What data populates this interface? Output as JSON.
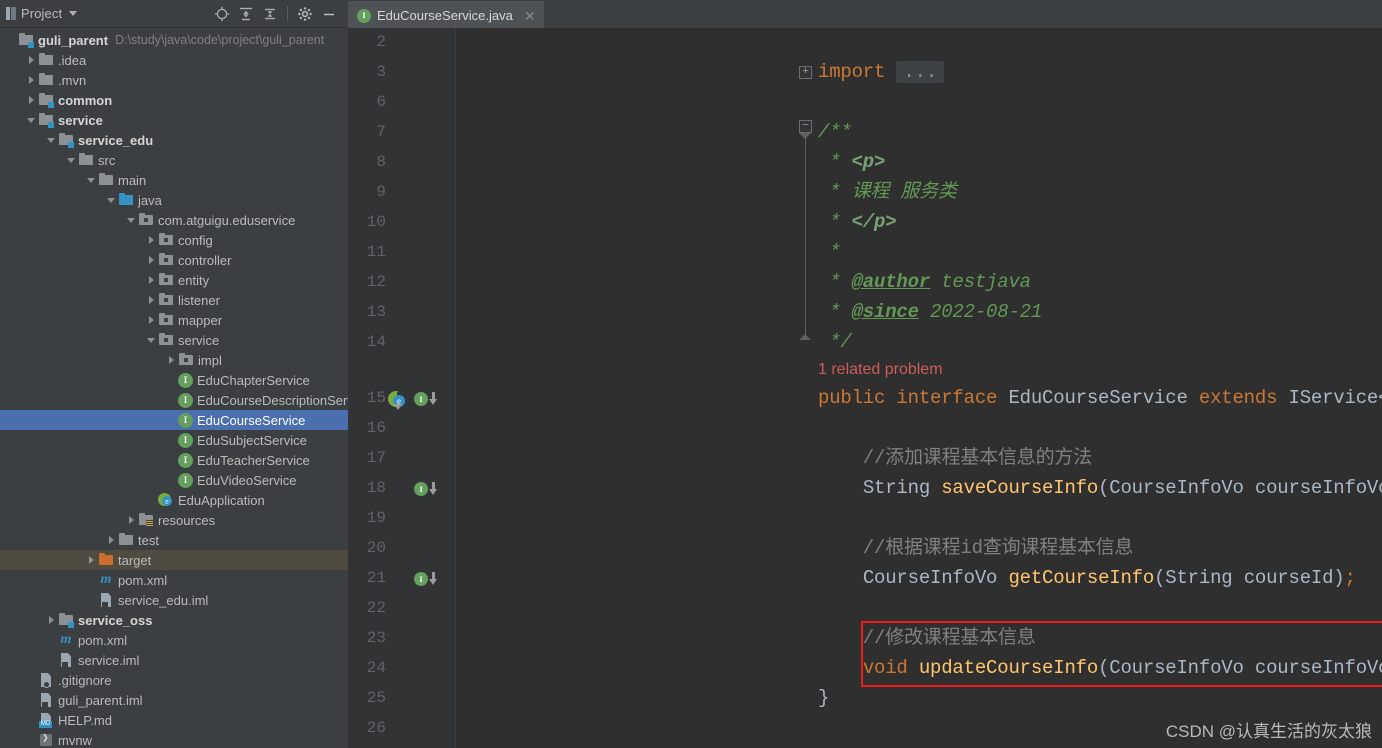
{
  "project_panel": {
    "title": "Project",
    "title_icon": "project-view-icon",
    "caret_icon": "chevron-down-icon",
    "toolbar": [
      {
        "name": "locate-file-icon",
        "label": "Select Opened File"
      },
      {
        "name": "expand-all-icon",
        "label": "Expand All"
      },
      {
        "name": "collapse-all-icon",
        "label": "Collapse All"
      },
      {
        "name": "gear-icon",
        "label": "Options"
      },
      {
        "name": "minimize-icon",
        "label": "Hide"
      }
    ],
    "tree": [
      {
        "label": "guli_parent",
        "path": "D:\\study\\java\\code\\project\\guli_parent",
        "indent": 0,
        "arrow": "none",
        "icon": "module-folder",
        "bold": true,
        "state": "normal"
      },
      {
        "label": ".idea",
        "path": "",
        "indent": 1,
        "arrow": "closed",
        "icon": "folder",
        "bold": false,
        "state": "normal"
      },
      {
        "label": ".mvn",
        "path": "",
        "indent": 1,
        "arrow": "closed",
        "icon": "folder",
        "bold": false,
        "state": "normal"
      },
      {
        "label": "common",
        "path": "",
        "indent": 1,
        "arrow": "closed",
        "icon": "module-folder",
        "bold": true,
        "state": "normal"
      },
      {
        "label": "service",
        "path": "",
        "indent": 1,
        "arrow": "open",
        "icon": "module-folder",
        "bold": true,
        "state": "normal"
      },
      {
        "label": "service_edu",
        "path": "",
        "indent": 2,
        "arrow": "open",
        "icon": "module-folder",
        "bold": true,
        "state": "normal"
      },
      {
        "label": "src",
        "path": "",
        "indent": 3,
        "arrow": "open",
        "icon": "folder",
        "bold": false,
        "state": "normal"
      },
      {
        "label": "main",
        "path": "",
        "indent": 4,
        "arrow": "open",
        "icon": "folder",
        "bold": false,
        "state": "normal"
      },
      {
        "label": "java",
        "path": "",
        "indent": 5,
        "arrow": "open",
        "icon": "source-folder",
        "bold": false,
        "state": "normal"
      },
      {
        "label": "com.atguigu.eduservice",
        "path": "",
        "indent": 6,
        "arrow": "open",
        "icon": "package",
        "bold": false,
        "state": "normal"
      },
      {
        "label": "config",
        "path": "",
        "indent": 7,
        "arrow": "closed",
        "icon": "package",
        "bold": false,
        "state": "normal"
      },
      {
        "label": "controller",
        "path": "",
        "indent": 7,
        "arrow": "closed",
        "icon": "package",
        "bold": false,
        "state": "normal"
      },
      {
        "label": "entity",
        "path": "",
        "indent": 7,
        "arrow": "closed",
        "icon": "package",
        "bold": false,
        "state": "normal"
      },
      {
        "label": "listener",
        "path": "",
        "indent": 7,
        "arrow": "closed",
        "icon": "package",
        "bold": false,
        "state": "normal"
      },
      {
        "label": "mapper",
        "path": "",
        "indent": 7,
        "arrow": "closed",
        "icon": "package",
        "bold": false,
        "state": "normal"
      },
      {
        "label": "service",
        "path": "",
        "indent": 7,
        "arrow": "open",
        "icon": "package",
        "bold": false,
        "state": "normal"
      },
      {
        "label": "impl",
        "path": "",
        "indent": 8,
        "arrow": "closed",
        "icon": "package",
        "bold": false,
        "state": "normal"
      },
      {
        "label": "EduChapterService",
        "path": "",
        "indent": 8,
        "arrow": "none",
        "icon": "interface",
        "bold": false,
        "state": "normal"
      },
      {
        "label": "EduCourseDescriptionService",
        "path": "",
        "indent": 8,
        "arrow": "none",
        "icon": "interface",
        "bold": false,
        "state": "normal"
      },
      {
        "label": "EduCourseService",
        "path": "",
        "indent": 8,
        "arrow": "none",
        "icon": "interface",
        "bold": false,
        "state": "selected"
      },
      {
        "label": "EduSubjectService",
        "path": "",
        "indent": 8,
        "arrow": "none",
        "icon": "interface",
        "bold": false,
        "state": "normal"
      },
      {
        "label": "EduTeacherService",
        "path": "",
        "indent": 8,
        "arrow": "none",
        "icon": "interface",
        "bold": false,
        "state": "normal"
      },
      {
        "label": "EduVideoService",
        "path": "",
        "indent": 8,
        "arrow": "none",
        "icon": "interface",
        "bold": false,
        "state": "normal"
      },
      {
        "label": "EduApplication",
        "path": "",
        "indent": 7,
        "arrow": "none",
        "icon": "spring-class",
        "bold": false,
        "state": "normal"
      },
      {
        "label": "resources",
        "path": "",
        "indent": 6,
        "arrow": "closed",
        "icon": "resource-folder",
        "bold": false,
        "state": "normal"
      },
      {
        "label": "test",
        "path": "",
        "indent": 5,
        "arrow": "closed",
        "icon": "folder",
        "bold": false,
        "state": "normal"
      },
      {
        "label": "target",
        "path": "",
        "indent": 4,
        "arrow": "closed",
        "icon": "excluded-folder",
        "bold": false,
        "state": "hovered"
      },
      {
        "label": "pom.xml",
        "path": "",
        "indent": 4,
        "arrow": "none",
        "icon": "maven",
        "bold": false,
        "state": "normal"
      },
      {
        "label": "service_edu.iml",
        "path": "",
        "indent": 4,
        "arrow": "none",
        "icon": "iml-file",
        "bold": false,
        "state": "normal"
      },
      {
        "label": "service_oss",
        "path": "",
        "indent": 2,
        "arrow": "closed",
        "icon": "module-folder",
        "bold": true,
        "state": "normal"
      },
      {
        "label": "pom.xml",
        "path": "",
        "indent": 2,
        "arrow": "none",
        "icon": "maven",
        "bold": false,
        "state": "normal"
      },
      {
        "label": "service.iml",
        "path": "",
        "indent": 2,
        "arrow": "none",
        "icon": "iml-file",
        "bold": false,
        "state": "normal"
      },
      {
        "label": ".gitignore",
        "path": "",
        "indent": 1,
        "arrow": "none",
        "icon": "gitignore-file",
        "bold": false,
        "state": "normal"
      },
      {
        "label": "guli_parent.iml",
        "path": "",
        "indent": 1,
        "arrow": "none",
        "icon": "iml-file",
        "bold": false,
        "state": "normal"
      },
      {
        "label": "HELP.md",
        "path": "",
        "indent": 1,
        "arrow": "none",
        "icon": "markdown-file",
        "bold": false,
        "state": "normal"
      },
      {
        "label": "mvnw",
        "path": "",
        "indent": 1,
        "arrow": "none",
        "icon": "shell-file",
        "bold": false,
        "state": "normal"
      }
    ]
  },
  "editor": {
    "tab": {
      "label": "EduCourseService.java",
      "icon": "interface-icon",
      "close_icon": "close-icon"
    },
    "inlay_hint": "1 related problem",
    "fold_placeholder": "...",
    "gutter_markers": [
      {
        "line": 15,
        "name": "spring-bean-marker"
      },
      {
        "line": 15,
        "name": "implemented-by-marker"
      },
      {
        "line": 18,
        "name": "implemented-by-marker"
      },
      {
        "line": 21,
        "name": "implemented-by-marker"
      }
    ],
    "lines": [
      {
        "n": 2,
        "tokens": []
      },
      {
        "n": 3,
        "tokens": [
          {
            "t": "import ",
            "c": "kw"
          },
          {
            "t": "...",
            "c": "fold"
          }
        ]
      },
      {
        "n": 6,
        "tokens": []
      },
      {
        "n": 7,
        "tokens": [
          {
            "t": "/**",
            "c": "doc"
          }
        ]
      },
      {
        "n": 8,
        "tokens": [
          {
            "t": " * ",
            "c": "doc"
          },
          {
            "t": "<p>",
            "c": "docbold"
          }
        ]
      },
      {
        "n": 9,
        "tokens": [
          {
            "t": " * 课程 服务类",
            "c": "doc"
          }
        ]
      },
      {
        "n": 10,
        "tokens": [
          {
            "t": " * ",
            "c": "doc"
          },
          {
            "t": "</p>",
            "c": "docbold"
          }
        ]
      },
      {
        "n": 11,
        "tokens": [
          {
            "t": " *",
            "c": "doc"
          }
        ]
      },
      {
        "n": 12,
        "tokens": [
          {
            "t": " * ",
            "c": "doc"
          },
          {
            "t": "@author",
            "c": "doctag"
          },
          {
            "t": " testjava",
            "c": "doc"
          }
        ]
      },
      {
        "n": 13,
        "tokens": [
          {
            "t": " * ",
            "c": "doc"
          },
          {
            "t": "@since",
            "c": "doctag"
          },
          {
            "t": " 2022-08-21",
            "c": "doc"
          }
        ]
      },
      {
        "n": 14,
        "tokens": [
          {
            "t": " */",
            "c": "doc"
          }
        ]
      },
      {
        "n": 15,
        "tokens": [
          {
            "t": "public interface ",
            "c": "kw"
          },
          {
            "t": "EduCourseService",
            "c": "type"
          },
          {
            "t": " extends ",
            "c": "kw"
          },
          {
            "t": "IService<EduCourse> {",
            "c": "type"
          }
        ]
      },
      {
        "n": 16,
        "tokens": []
      },
      {
        "n": 17,
        "tokens": [
          {
            "t": "    //添加课程基本信息的方法",
            "c": "cmt"
          }
        ]
      },
      {
        "n": 18,
        "tokens": [
          {
            "t": "    ",
            "c": "plain"
          },
          {
            "t": "String",
            "c": "type"
          },
          {
            "t": " ",
            "c": "plain"
          },
          {
            "t": "saveCourseInfo",
            "c": "method"
          },
          {
            "t": "(CourseInfoVo courseInfoVo)",
            "c": "type"
          },
          {
            "t": ";",
            "c": "semi"
          }
        ]
      },
      {
        "n": 19,
        "tokens": []
      },
      {
        "n": 20,
        "tokens": [
          {
            "t": "    //根据课程id查询课程基本信息",
            "c": "cmt"
          }
        ]
      },
      {
        "n": 21,
        "tokens": [
          {
            "t": "    ",
            "c": "plain"
          },
          {
            "t": "CourseInfoVo",
            "c": "type"
          },
          {
            "t": " ",
            "c": "plain"
          },
          {
            "t": "getCourseInfo",
            "c": "method"
          },
          {
            "t": "(String courseId)",
            "c": "type"
          },
          {
            "t": ";",
            "c": "semi"
          }
        ]
      },
      {
        "n": 22,
        "tokens": []
      },
      {
        "n": 23,
        "tokens": [
          {
            "t": "    //修改课程基本信息",
            "c": "cmt"
          }
        ]
      },
      {
        "n": 24,
        "tokens": [
          {
            "t": "    ",
            "c": "plain"
          },
          {
            "t": "void",
            "c": "kw"
          },
          {
            "t": " ",
            "c": "plain"
          },
          {
            "t": "updateCourseInfo",
            "c": "method"
          },
          {
            "t": "(CourseInfoVo courseInfoVo)",
            "c": "type"
          },
          {
            "t": ";",
            "c": "semi"
          }
        ]
      },
      {
        "n": 25,
        "tokens": [
          {
            "t": "}",
            "c": "type"
          }
        ]
      },
      {
        "n": 26,
        "tokens": []
      }
    ],
    "annotation_box": {
      "name": "red-highlight-box",
      "color": "#ee1c1c",
      "covers_lines": "23-24"
    }
  },
  "watermark": {
    "text": "CSDN @认真生活的灰太狼"
  },
  "colors": {
    "panel_bg": "#3c3f41",
    "editor_bg": "#2f2f2f",
    "gutter_bg": "#313335",
    "selection_blue": "#4b6eaf",
    "hover_olive": "#4f4b41",
    "keyword_orange": "#cc7832",
    "method_yellow": "#ffc66d",
    "type_gray": "#a9b7c6",
    "comment_gray": "#808080",
    "javadoc_green": "#629755",
    "problem_red": "#cd5c5c",
    "annotation_red": "#ee1c1c"
  }
}
